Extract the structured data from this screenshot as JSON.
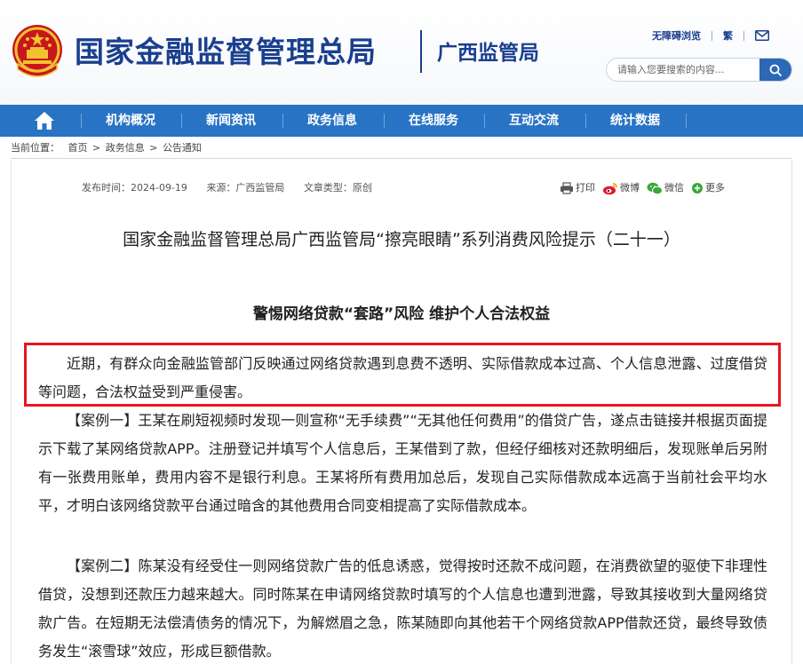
{
  "header": {
    "site_title": "国家金融监督管理总局",
    "sub_title": "广西监管局",
    "util_accessible": "无障碍浏览",
    "util_traditional": "繁",
    "search_placeholder": "请输入您要搜索的内容..."
  },
  "nav": {
    "items": [
      {
        "label": "机构概况"
      },
      {
        "label": "新闻资讯"
      },
      {
        "label": "政务信息"
      },
      {
        "label": "在线服务"
      },
      {
        "label": "互动交流"
      },
      {
        "label": "统计数据"
      }
    ]
  },
  "breadcrumb": {
    "prefix": "当前位置：",
    "items": [
      "首页",
      "政务信息",
      "公告通知"
    ],
    "separator": ">"
  },
  "meta": {
    "date": "发布时间：2024-09-19",
    "source": "来源：广西监管局",
    "type": "文章类型：原创"
  },
  "share": {
    "print": "打印",
    "weibo": "微博",
    "wechat": "微信",
    "more": "更多"
  },
  "article": {
    "title": "国家金融监督管理总局广西监管局“擦亮眼睛”系列消费风险提示（二十一）",
    "subtitle": "警惕网络贷款“套路”风险  维护个人合法权益",
    "paragraphs": [
      "近期，有群众向金融监管部门反映通过网络贷款遇到息费不透明、实际借款成本过高、个人信息泄露、过度借贷等问题，合法权益受到严重侵害。",
      "【案例一】王某在刷短视频时发现一则宣称“无手续费”“无其他任何费用”的借贷广告，遂点击链接并根据页面提示下载了某网络贷款APP。注册登记并填写个人信息后，王某借到了款，但经仔细核对还款明细后，发现账单后另附有一张费用账单，费用内容不是银行利息。王某将所有费用加总后，发现自己实际借款成本远高于当前社会平均水平，才明白该网络贷款平台通过暗含的其他费用合同变相提高了实际借款成本。",
      "【案例二】陈某没有经受住一则网络贷款广告的低息诱惑，觉得按时还款不成问题，在消费欲望的驱使下非理性借贷，没想到还款压力越来越大。同时陈某在申请网络贷款时填写的个人信息也遭到泄露，导致其接收到大量网络贷款广告。在短期无法偿清债务的情况下，为解燃眉之急，陈某随即向其他若干个网络贷款APP借款还贷，最终导致债务发生“滚雪球”效应，形成巨额借款。"
    ]
  },
  "colors": {
    "brand_blue": "#1a3f8f",
    "nav_blue": "#2873c4",
    "highlight_red": "#e8161c"
  }
}
